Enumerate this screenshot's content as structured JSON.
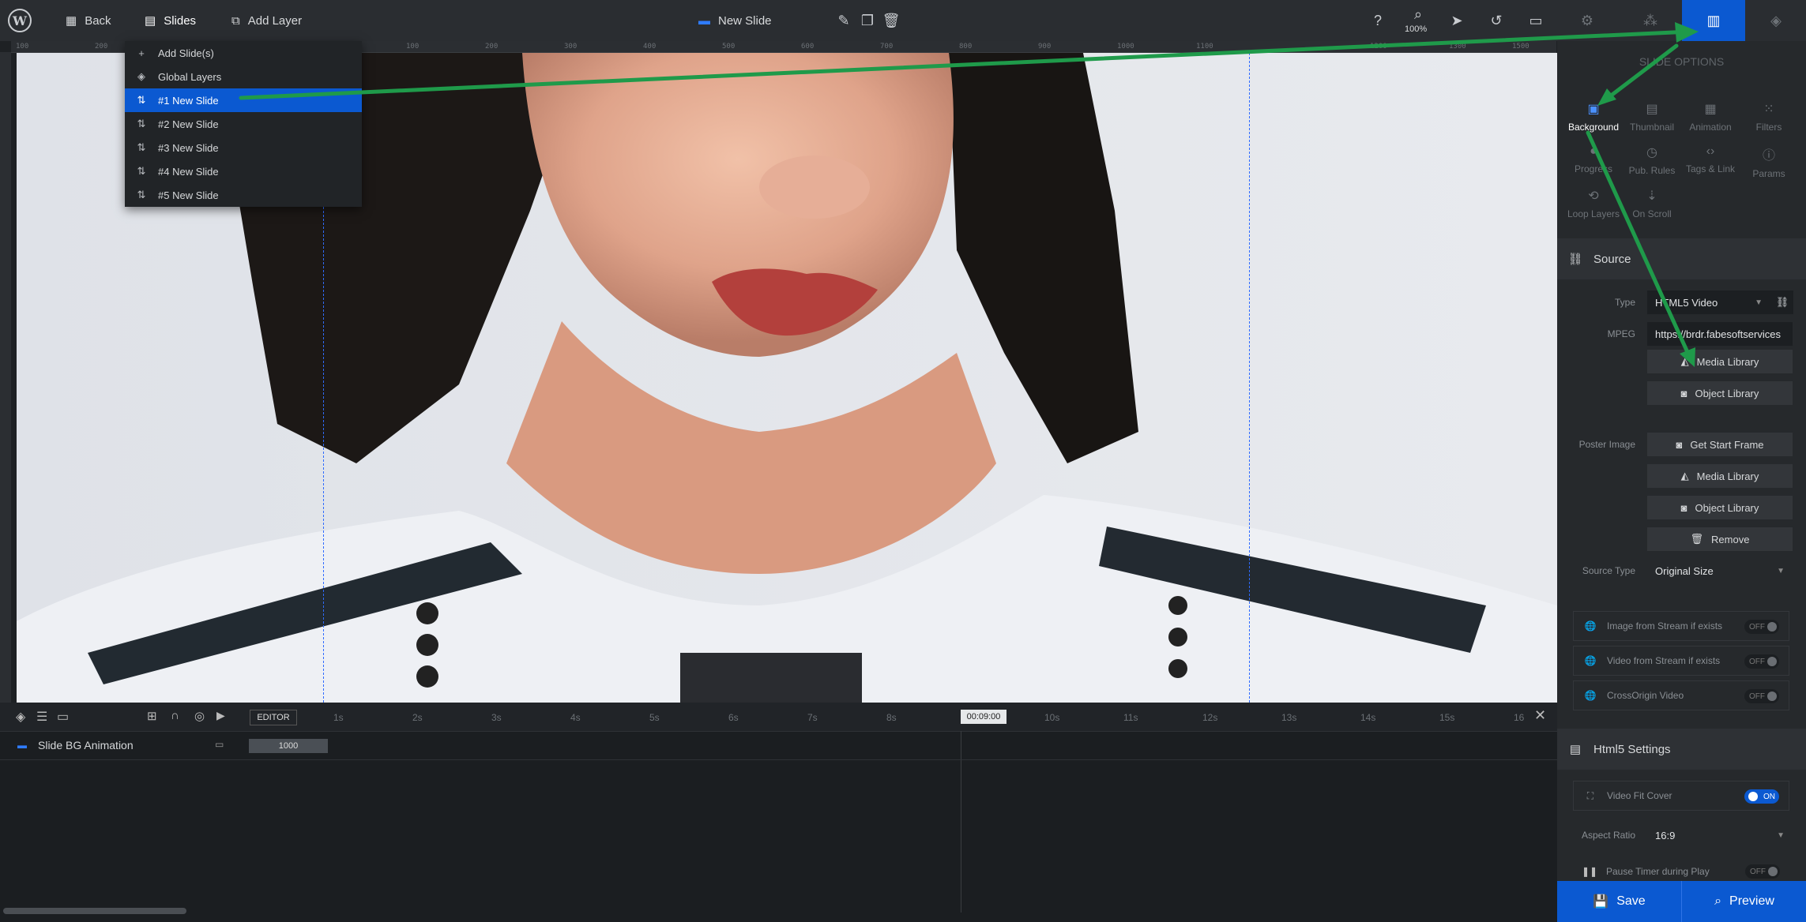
{
  "topbar": {
    "back_label": "Back",
    "slides_label": "Slides",
    "add_layer_label": "Add Layer",
    "slide_title": "New Slide",
    "zoom": "100%"
  },
  "ruler": {
    "ticks": [
      "100",
      "200",
      "100",
      "200",
      "300",
      "400",
      "500",
      "600",
      "700",
      "800",
      "900",
      "1000",
      "1100",
      "1200",
      "1300",
      "1400",
      "1500"
    ]
  },
  "slides_menu": {
    "items": [
      {
        "label": "Add Slide(s)",
        "icon": "plus-icon"
      },
      {
        "label": "Global Layers",
        "icon": "layers-icon"
      },
      {
        "label": "#1 New Slide",
        "icon": "sort-icon",
        "active": true
      },
      {
        "label": "#2 New Slide",
        "icon": "sort-icon"
      },
      {
        "label": "#3 New Slide",
        "icon": "sort-icon"
      },
      {
        "label": "#4 New Slide",
        "icon": "sort-icon"
      },
      {
        "label": "#5 New Slide",
        "icon": "sort-icon"
      }
    ]
  },
  "panel": {
    "heading": "SLIDE OPTIONS",
    "tabs": [
      "Background",
      "Thumbnail",
      "Animation",
      "Filters",
      "Progress",
      "Pub. Rules",
      "Tags & Link",
      "Params",
      "Loop Layers",
      "On Scroll"
    ],
    "source": {
      "title": "Source",
      "type_label": "Type",
      "type_value": "HTML5 Video",
      "mpeg_label": "MPEG",
      "mpeg_value": "https://brdr.fabesoftservices",
      "media_library": "Media Library",
      "object_library": "Object Library",
      "poster_label": "Poster Image",
      "get_start_frame": "Get Start Frame",
      "poster_media_library": "Media Library",
      "poster_object_library": "Object Library",
      "remove": "Remove",
      "source_type_label": "Source Type",
      "source_type_value": "Original Size",
      "image_stream": "Image from Stream if exists",
      "video_stream": "Video from Stream if exists",
      "crossorigin": "CrossOrigin Video",
      "off": "OFF"
    },
    "html5": {
      "title": "Html5 Settings",
      "fit_cover": "Video Fit Cover",
      "on": "ON",
      "aspect_label": "Aspect Ratio",
      "aspect_value": "16:9",
      "pause_timer": "Pause Timer during Play",
      "off": "OFF"
    },
    "save": "Save",
    "preview": "Preview"
  },
  "timeline": {
    "editor_label": "EDITOR",
    "current_time": "00:09:00",
    "ticks": [
      "1s",
      "2s",
      "3s",
      "4s",
      "5s",
      "6s",
      "7s",
      "8s",
      "10s",
      "11s",
      "12s",
      "13s",
      "14s",
      "15s",
      "16"
    ],
    "layer_name": "Slide BG Animation",
    "bar_value": "1000"
  },
  "colors": {
    "accent": "#0b59d1",
    "annotation_arrow": "#1f9a4a"
  }
}
